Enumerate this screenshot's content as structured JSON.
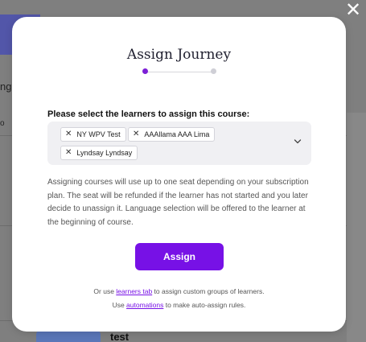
{
  "background": {
    "fragment_left_1": "ng",
    "fragment_left_2": "o",
    "fragment_right_col": "A",
    "bottom_item_title": "test"
  },
  "modal": {
    "title": "Assign Journey",
    "select_label": "Please select the learners to assign this course:",
    "selected_learners": [
      "NY WPV Test",
      "AAAllama AAA Lima",
      "Lyndsay Lyndsay"
    ],
    "description": "Assigning courses will use up to one seat depending on your subscription plan. The seat will be refunded if the learner has not started and you later decide to unassign it. Language selection will be offered to the learner at the beginning of course.",
    "assign_button": "Assign",
    "hint1_prefix": "Or use ",
    "hint1_link": "learners tab",
    "hint1_suffix": " to assign custom groups of learners.",
    "hint2_prefix": "Use ",
    "hint2_link": "automations",
    "hint2_suffix": " to make auto-assign rules."
  },
  "colors": {
    "accent": "#7711e6",
    "step_active": "#7c1fd6",
    "overlay": "#7f7f7f"
  },
  "icons": {
    "close": "close-icon",
    "chip_remove": "x-icon",
    "dropdown": "chevron-down-icon"
  },
  "stepper": {
    "current_step": 1,
    "total_steps": 2
  }
}
